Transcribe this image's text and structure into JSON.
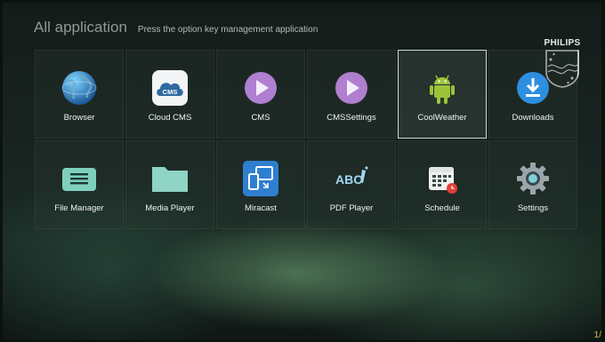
{
  "header": {
    "title": "All application",
    "subtitle": "Press the option key management application"
  },
  "logo": {
    "brand": "PHILIPS"
  },
  "apps": [
    {
      "label": "Browser",
      "icon": "globe-icon"
    },
    {
      "label": "Cloud CMS",
      "icon": "cloud-cms-icon",
      "badge": "CMS"
    },
    {
      "label": "CMS",
      "icon": "play-icon"
    },
    {
      "label": "CMSSettings",
      "icon": "play-icon"
    },
    {
      "label": "CoolWeather",
      "icon": "android-icon",
      "selected": true
    },
    {
      "label": "Downloads",
      "icon": "download-icon"
    },
    {
      "label": "File Manager",
      "icon": "folder-list-icon"
    },
    {
      "label": "Media Player",
      "icon": "folder-icon"
    },
    {
      "label": "Miracast",
      "icon": "miracast-icon"
    },
    {
      "label": "PDF Player",
      "icon": "abc-icon",
      "badge": "ABC"
    },
    {
      "label": "Schedule",
      "icon": "calendar-icon"
    },
    {
      "label": "Settings",
      "icon": "gear-icon"
    }
  ],
  "pager": {
    "text": "1/"
  },
  "colors": {
    "accent_purple": "#b07fd0",
    "download_blue": "#2e8fe0",
    "android_green": "#9bc43b",
    "teal": "#7fcfbf",
    "cloud_blue": "#2f6aa0",
    "miracast_blue": "#2f7fd0",
    "pager_yellow": "#d9c04a"
  }
}
